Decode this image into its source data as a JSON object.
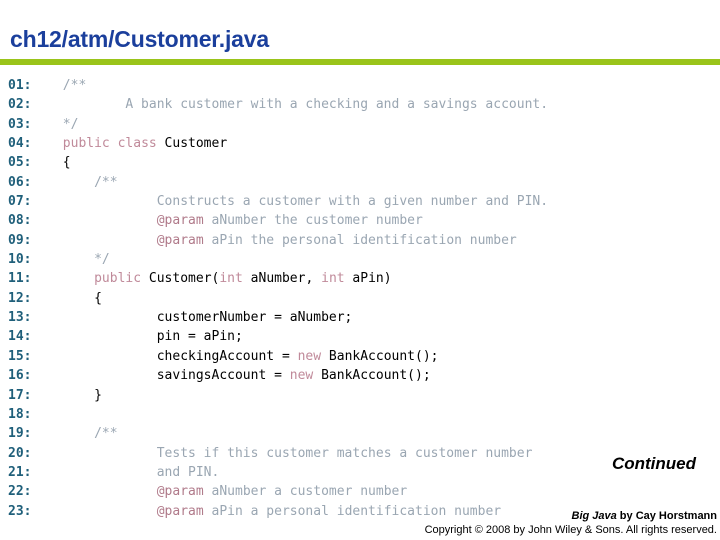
{
  "slide": {
    "title": "ch12/atm/Customer.java",
    "accent_green": "#9ac41a",
    "title_color": "#1b3f9c"
  },
  "code": {
    "language": "java",
    "line_number_color": "#1f5f7a",
    "comment_color": "#9aa6b2",
    "keyword_color": "#c08a9a",
    "javadoc_tag_color": "#b07a8a",
    "text_color": "#000000",
    "lines": [
      {
        "num": "01:",
        "tokens": [
          {
            "t": "/**",
            "c": "cmt",
            "indent": 1
          }
        ]
      },
      {
        "num": "02:",
        "tokens": [
          {
            "t": "A bank customer with a checking and a savings account.",
            "c": "cmt",
            "indent": 3
          }
        ]
      },
      {
        "num": "03:",
        "tokens": [
          {
            "t": "*/",
            "c": "cmt",
            "indent": 1
          }
        ]
      },
      {
        "num": "04:",
        "tokens": [
          {
            "t": "public class ",
            "c": "kw",
            "indent": 1
          },
          {
            "t": "Customer",
            "c": "plain"
          }
        ]
      },
      {
        "num": "05:",
        "tokens": [
          {
            "t": "{",
            "c": "plain",
            "indent": 1
          }
        ]
      },
      {
        "num": "06:",
        "tokens": [
          {
            "t": "/**",
            "c": "cmt",
            "indent": 2
          }
        ]
      },
      {
        "num": "07:",
        "tokens": [
          {
            "t": "Constructs a customer with a given number and PIN.",
            "c": "cmt",
            "indent": 4
          }
        ]
      },
      {
        "num": "08:",
        "tokens": [
          {
            "t": "@param",
            "c": "tag",
            "indent": 4
          },
          {
            "t": " aNumber the customer number",
            "c": "cmt"
          }
        ]
      },
      {
        "num": "09:",
        "tokens": [
          {
            "t": "@param",
            "c": "tag",
            "indent": 4
          },
          {
            "t": " aPin the personal identification number",
            "c": "cmt"
          }
        ]
      },
      {
        "num": "10:",
        "tokens": [
          {
            "t": "*/",
            "c": "cmt",
            "indent": 2
          }
        ]
      },
      {
        "num": "11:",
        "tokens": [
          {
            "t": "public ",
            "c": "kw",
            "indent": 2
          },
          {
            "t": "Customer(",
            "c": "plain"
          },
          {
            "t": "int",
            "c": "kw"
          },
          {
            "t": " aNumber, ",
            "c": "plain"
          },
          {
            "t": "int",
            "c": "kw"
          },
          {
            "t": " aPin)",
            "c": "plain"
          }
        ]
      },
      {
        "num": "12:",
        "tokens": [
          {
            "t": "{",
            "c": "plain",
            "indent": 2
          }
        ]
      },
      {
        "num": "13:",
        "tokens": [
          {
            "t": "customerNumber = aNumber;",
            "c": "plain",
            "indent": 4
          }
        ]
      },
      {
        "num": "14:",
        "tokens": [
          {
            "t": "pin = aPin;",
            "c": "plain",
            "indent": 4
          }
        ]
      },
      {
        "num": "15:",
        "tokens": [
          {
            "t": "checkingAccount = ",
            "c": "plain",
            "indent": 4
          },
          {
            "t": "new",
            "c": "kw"
          },
          {
            "t": " BankAccount();",
            "c": "plain"
          }
        ]
      },
      {
        "num": "16:",
        "tokens": [
          {
            "t": "savingsAccount = ",
            "c": "plain",
            "indent": 4
          },
          {
            "t": "new",
            "c": "kw"
          },
          {
            "t": " BankAccount();",
            "c": "plain"
          }
        ]
      },
      {
        "num": "17:",
        "tokens": [
          {
            "t": "}",
            "c": "plain",
            "indent": 2
          }
        ]
      },
      {
        "num": "18:",
        "tokens": []
      },
      {
        "num": "19:",
        "tokens": [
          {
            "t": "/**",
            "c": "cmt",
            "indent": 2
          }
        ]
      },
      {
        "num": "20:",
        "tokens": [
          {
            "t": "Tests if this customer matches a customer number",
            "c": "cmt",
            "indent": 4
          }
        ]
      },
      {
        "num": "21:",
        "tokens": [
          {
            "t": "and PIN.",
            "c": "cmt",
            "indent": 4
          }
        ]
      },
      {
        "num": "22:",
        "tokens": [
          {
            "t": "@param",
            "c": "tag",
            "indent": 4
          },
          {
            "t": " aNumber a customer number",
            "c": "cmt"
          }
        ]
      },
      {
        "num": "23:",
        "tokens": [
          {
            "t": "@param",
            "c": "tag",
            "indent": 4
          },
          {
            "t": " aPin a personal identification number",
            "c": "cmt"
          }
        ]
      }
    ]
  },
  "continued_label": "Continued",
  "footer": {
    "book_title": "Big Java",
    "byline": " by Cay Horstmann",
    "copyright": "Copyright © 2008 by John Wiley & Sons.  All rights reserved."
  }
}
